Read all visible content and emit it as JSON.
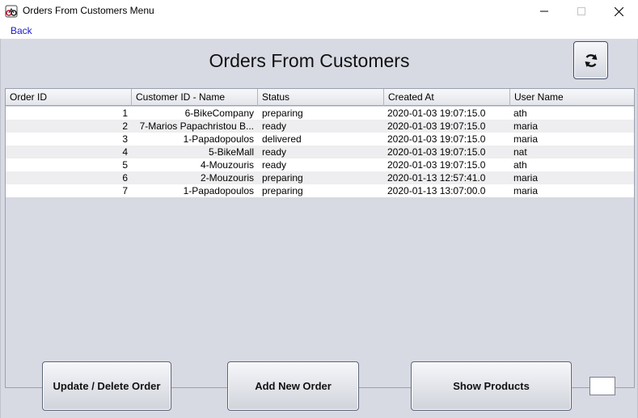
{
  "window": {
    "title": "Orders From Customers Menu",
    "icon": "bike-app-icon",
    "controls": [
      "minimize-icon",
      "maximize-icon",
      "close-icon"
    ]
  },
  "menu": {
    "back_label": "Back"
  },
  "page": {
    "title": "Orders From Customers",
    "refresh_icon": "refresh-icon"
  },
  "table": {
    "columns": [
      "Order ID",
      "Customer ID - Name",
      "Status",
      "Created At",
      "User Name"
    ],
    "rows": [
      [
        "1",
        "6-BikeCompany",
        "preparing",
        "2020-01-03 19:07:15.0",
        "ath"
      ],
      [
        "2",
        "7-Marios Papachristou B...",
        "ready",
        "2020-01-03 19:07:15.0",
        "maria"
      ],
      [
        "3",
        "1-Papadopoulos",
        "delivered",
        "2020-01-03 19:07:15.0",
        "maria"
      ],
      [
        "4",
        "5-BikeMall",
        "ready",
        "2020-01-03 19:07:15.0",
        "nat"
      ],
      [
        "5",
        "4-Mouzouris",
        "ready",
        "2020-01-03 19:07:15.0",
        "ath"
      ],
      [
        "6",
        "2-Mouzouris",
        "preparing",
        "2020-01-13 12:57:41.0",
        "maria"
      ],
      [
        "7",
        "1-Papadopoulos",
        "preparing",
        "2020-01-13 13:07:00.0",
        "maria"
      ]
    ]
  },
  "buttons": {
    "update_delete": "Update / Delete Order",
    "add_new": "Add New Order",
    "show_products": "Show Products"
  },
  "colors": {
    "link": "#1a1acc",
    "panel": "#d8dae3",
    "row_alt": "#eeeef0"
  }
}
